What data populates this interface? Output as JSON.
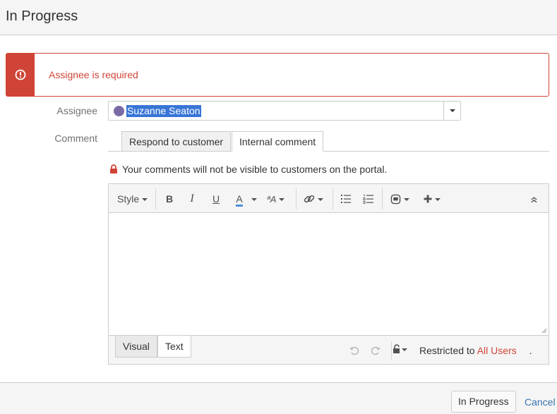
{
  "header": {
    "title": "In Progress"
  },
  "error": {
    "message": "Assignee is required",
    "icon": "exclamation-circle-icon"
  },
  "form": {
    "assignee_label": "Assignee",
    "assignee_value": "Suzanne Seaton",
    "comment_label": "Comment"
  },
  "comment_tabs": [
    "Respond to customer",
    "Internal comment"
  ],
  "notice": "Your comments will not be visible to customers on the portal.",
  "toolbar": {
    "style_label": "Style",
    "bold": "B",
    "italic": "I",
    "underline": "U",
    "text_color": "A",
    "text_size": "ªA",
    "icons": [
      "link-icon",
      "bullet-list-icon",
      "numbered-list-icon",
      "emoticon-icon",
      "insert-more-icon",
      "collapse-toolbar-icon"
    ]
  },
  "editor_modes": [
    "Visual",
    "Text"
  ],
  "restriction": {
    "prefix": "Restricted to",
    "target": "All Users",
    "suffix": "."
  },
  "footer": {
    "submit_label": "In Progress",
    "cancel_label": "Cancel"
  },
  "colors": {
    "error": "#d04437",
    "link": "#3b73af",
    "selection": "#3875d7"
  }
}
